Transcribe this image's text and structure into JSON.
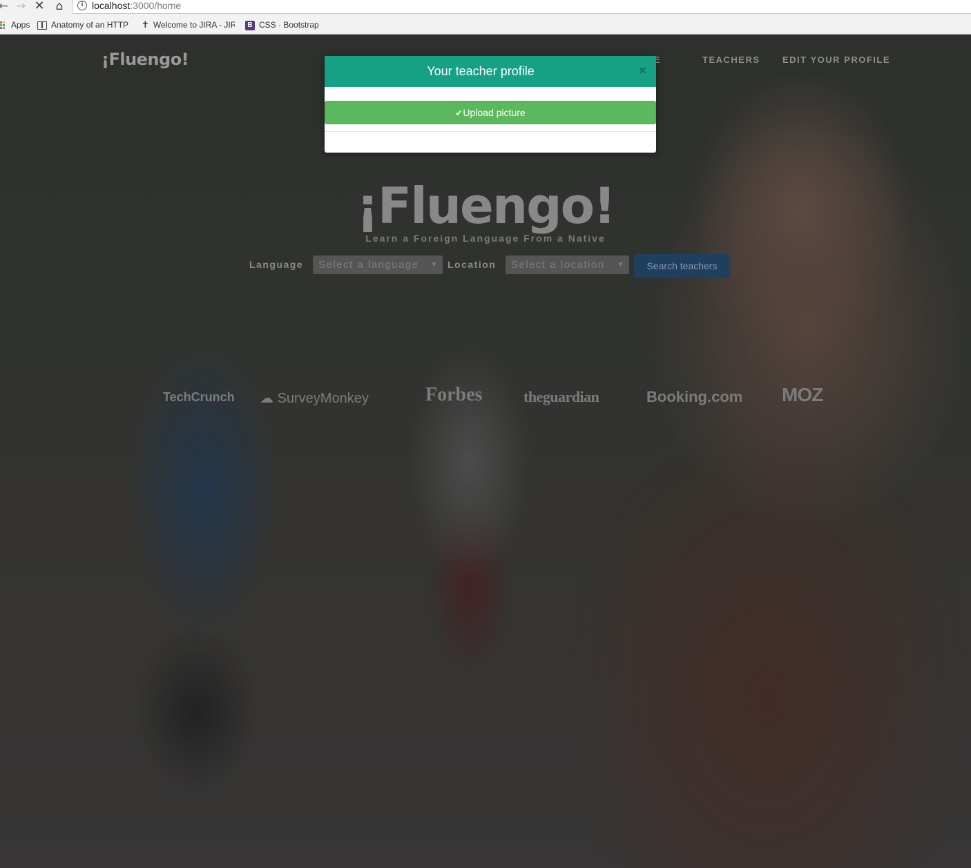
{
  "browser": {
    "url_host": "localhost",
    "url_path": ":3000/home",
    "bookmarks": [
      {
        "label": "Apps",
        "icon": "apps-grid-icon"
      },
      {
        "label": "Anatomy of an HTTP T",
        "icon": "book-icon"
      },
      {
        "label": "Welcome to JIRA - JIR",
        "icon": "jira-icon"
      },
      {
        "label": "CSS · Bootstrap",
        "icon": "bootstrap-icon"
      }
    ]
  },
  "site": {
    "logo": "¡Fluengo!",
    "nav": [
      "HOME",
      "TEACHERS",
      "EDIT YOUR PROFILE"
    ],
    "hero_title": "¡Fluengo!",
    "hero_subtitle": "Learn a Foreign Language From a Native",
    "search": {
      "language_label": "Language",
      "language_placeholder": "Select a language",
      "location_label": "Location",
      "location_placeholder": "Select a location",
      "button": "Search teachers"
    },
    "press": [
      "TechCrunch",
      "SurveyMonkey",
      "Forbes",
      "theguardian",
      "Booking.com",
      "MOZ"
    ]
  },
  "modal": {
    "title": "Your teacher profile",
    "close": "×",
    "upload_button": "Upload picture",
    "header_color": "#16a085",
    "button_color": "#5cb85c"
  }
}
